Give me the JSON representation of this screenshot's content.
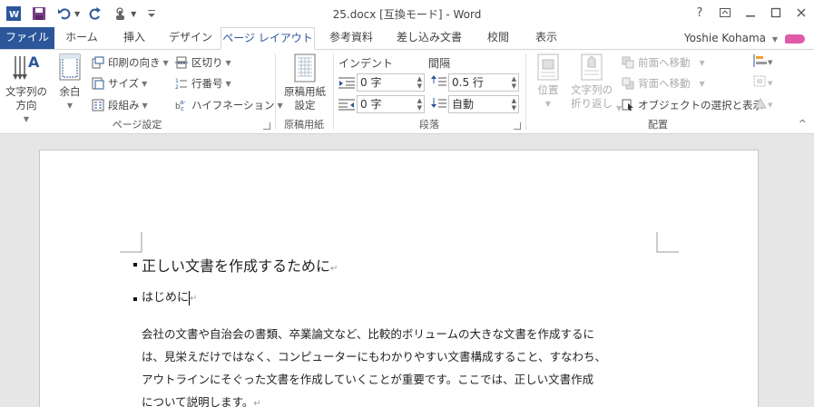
{
  "titlebar": {
    "title": "25.docx [互換モード] - Word",
    "help": "?",
    "controls": [
      "ribbon-options",
      "minimize",
      "maximize",
      "close"
    ]
  },
  "qat": {
    "icons": [
      "word-logo-icon",
      "save-icon",
      "undo-icon",
      "redo-icon",
      "touch-mode-icon",
      "customize-icon"
    ]
  },
  "tabs": [
    {
      "label": "ファイル"
    },
    {
      "label": "ホーム"
    },
    {
      "label": "挿入"
    },
    {
      "label": "デザイン"
    },
    {
      "label": "ページ レイアウト"
    },
    {
      "label": "参考資料"
    },
    {
      "label": "差し込み文書"
    },
    {
      "label": "校閲"
    },
    {
      "label": "表示"
    }
  ],
  "user": {
    "name": "Yoshie Kohama"
  },
  "ribbon": {
    "page_setup": {
      "label": "ページ設定",
      "text_direction": "文字列の\n方向",
      "margins": "余白",
      "orientation": "印刷の向き",
      "size": "サイズ",
      "columns": "段組み",
      "breaks": "区切り",
      "line_numbers": "行番号",
      "hyphenation": "ハイフネーション"
    },
    "manuscript": {
      "label": "原稿用紙",
      "button": "原稿用紙\n設定"
    },
    "paragraph": {
      "label": "段落",
      "indent_label": "インデント",
      "spacing_label": "間隔",
      "indent_left": "0 字",
      "indent_right": "0 字",
      "spacing_before": "0.5 行",
      "spacing_after": "自動"
    },
    "arrange": {
      "label": "配置",
      "position": "位置",
      "wrap_text": "文字列の\n折り返し",
      "bring_forward": "前面へ移動",
      "send_backward": "背面へ移動",
      "selection_pane": "オブジェクトの選択と表示"
    }
  },
  "document": {
    "heading": "正しい文書を作成するために",
    "subheading": "はじめに",
    "body": "会社の文書や自治会の書類、卒業論文など、比較的ボリュームの大きな文書を作成するには、見栄えだけではなく、コンピューターにもわかりやすい文書構成すること、すなわち、アウトラインにそぐった文書を作成していくことが重要です。ここでは、正しい文書作成について説明します。",
    "body_lines": [
      "会社の文書や自治会の書類、卒業論文など、比較的ボリュームの大きな文書を作成するに",
      "は、見栄えだけではなく、コンピューターにもわかりやすい文書構成すること、すなわち、",
      "アウトラインにそぐった文書を作成していくことが重要です。ここでは、正しい文書作成",
      "について説明します。"
    ],
    "para_mark": "↵"
  },
  "colors": {
    "accent": "#2b579a",
    "file_tab": "#2b579a",
    "avatar": "#e05aa8"
  }
}
